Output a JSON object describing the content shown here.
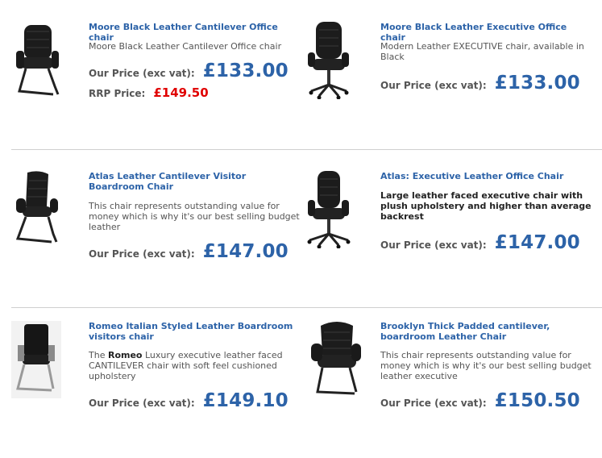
{
  "products": [
    {
      "title": "Moore Black Leather Cantilever Office chair",
      "description": "Moore Black Leather Cantilever Office chair",
      "price_label": "Our Price (exc vat):",
      "price": "£133.00",
      "rrp_label": "RRP Price:",
      "rrp": "£149.50",
      "image": "cantilever-chair"
    },
    {
      "title": "Moore Black Leather Executive Office chair",
      "description": "Modern Leather EXECUTIVE chair, available in Black",
      "price_label": "Our Price (exc vat):",
      "price": "£133.00",
      "image": "swivel-executive-chair"
    },
    {
      "title": "Atlas Leather Cantilever Visitor Boardroom Chair",
      "description": "This chair represents outstanding value for money which is why it's our best selling budget leather",
      "price_label": "Our Price (exc vat):",
      "price": "£147.00",
      "image": "cantilever-chair"
    },
    {
      "title": "Atlas: Executive Leather Office Chair",
      "description": "Large leather faced executive chair with plush upholstery and higher than average backrest",
      "price_label": "Our Price (exc vat):",
      "price": "£147.00",
      "image": "swivel-executive-chair"
    },
    {
      "title": "Romeo Italian Styled Leather Boardroom visitors chair",
      "description_pre": "The ",
      "description_bold": "Romeo",
      "description_post": " Luxury executive leather faced CANTILEVER chair with soft feel cushioned upholstery",
      "price_label": "Our Price (exc vat):",
      "price": "£149.10",
      "image": "chrome-cantilever-chair"
    },
    {
      "title": "Brooklyn Thick Padded cantilever, boardroom Leather Chair",
      "description": "This chair represents outstanding value for money which is why it's our best selling budget leather executive",
      "price_label": "Our Price (exc vat):",
      "price": "£150.50",
      "image": "padded-cantilever-chair"
    }
  ]
}
